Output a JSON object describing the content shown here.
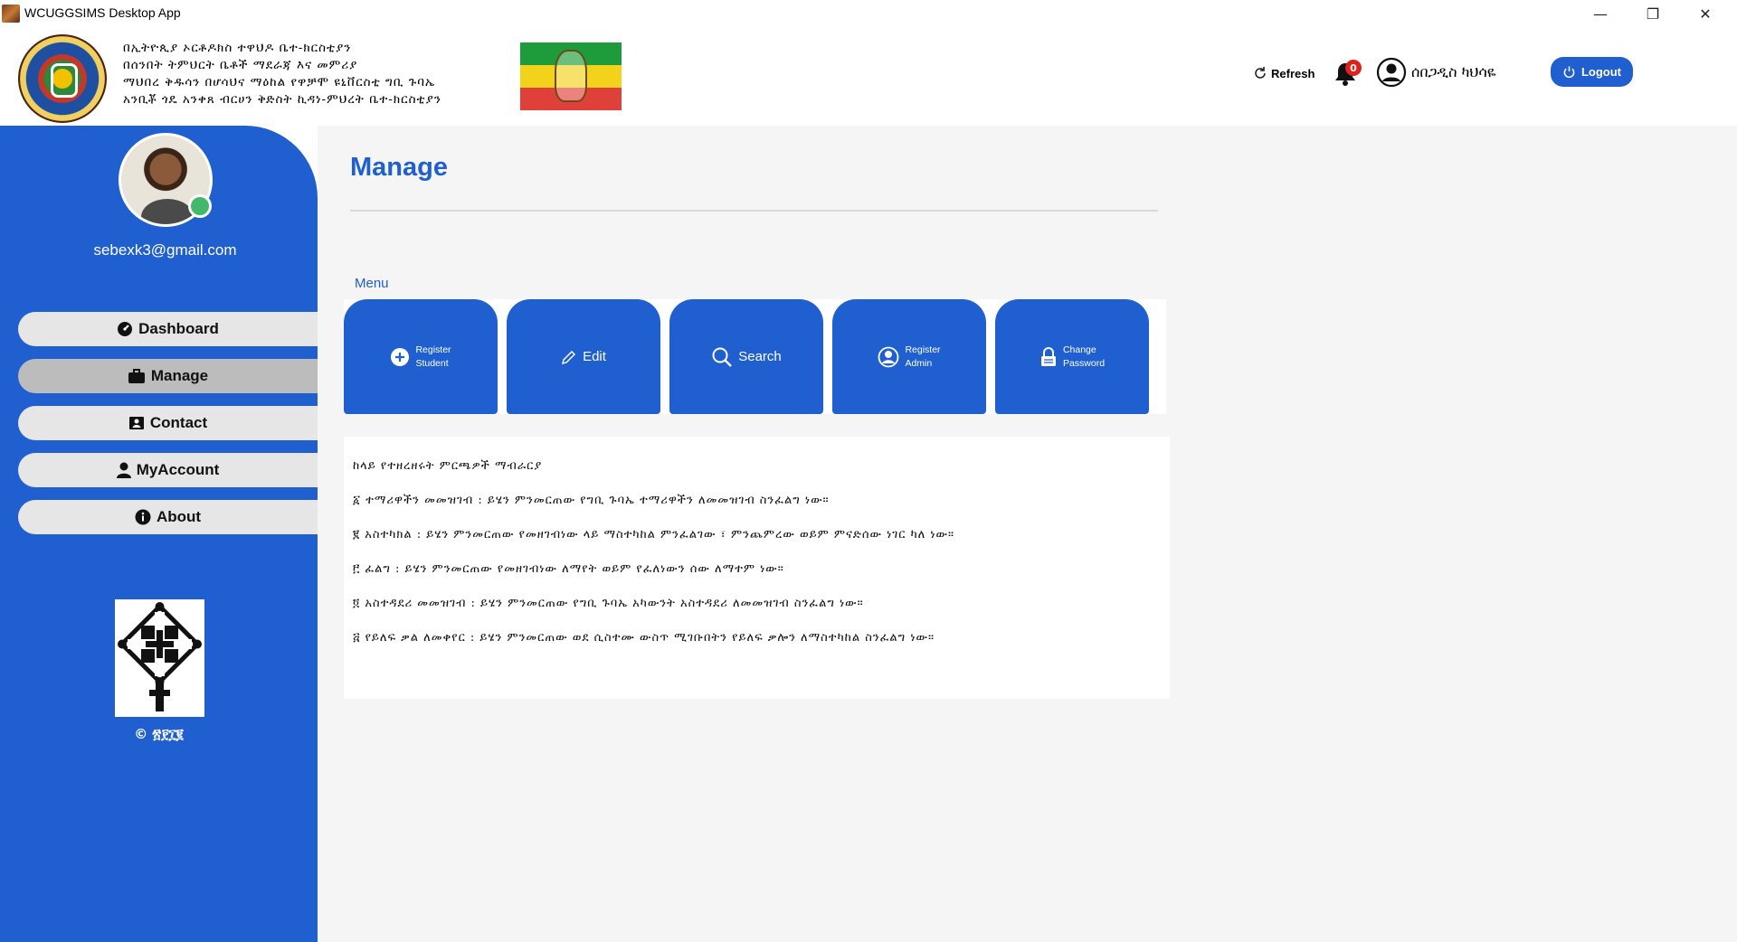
{
  "window": {
    "title": "WCUGGSIMS Desktop App",
    "minimize": "—",
    "maximize": "❐",
    "close": "✕"
  },
  "header": {
    "org_lines": [
      "በኢትዮጲያ ኦርቶዶክስ ተዋህዶ ቤተ-ክርስቲያን",
      "በሰንበት ትምህርት ቤቶች ማደራጃ እና መምሪያ",
      "ማህበረ ቅዱሳን በሆሳህና ማዕከል የዋቻሞ ዩኒቨርስቲ ግቢ ጉባኤ",
      "አንቢቾ ጎዴ አንቀጸ ብርሀን ቅድስት ኪዳነ-ምህረት ቤተ-ክርስቲያን"
    ],
    "refresh_label": "Refresh",
    "notification_count": "0",
    "user_name": "ሰበጋዲስ ካህሳዬ",
    "logout_label": "Logout"
  },
  "sidebar": {
    "email": "sebexk3@gmail.com",
    "nav": [
      {
        "label": "Dashboard",
        "icon": "dashboard-icon"
      },
      {
        "label": "Manage",
        "icon": "briefcase-icon"
      },
      {
        "label": "Contact",
        "icon": "contact-card-icon"
      },
      {
        "label": "MyAccount",
        "icon": "user-icon"
      },
      {
        "label": "About",
        "icon": "info-icon"
      }
    ],
    "copyright": "© ፳፻፲፪"
  },
  "main": {
    "title": "Manage",
    "menu_label": "Menu",
    "tiles": [
      {
        "line1": "Register",
        "line2": "Student",
        "icon": "plus-circle-icon"
      },
      {
        "line1": "Edit",
        "line2": "",
        "icon": "pencil-icon"
      },
      {
        "line1": "Search",
        "line2": "",
        "icon": "search-icon"
      },
      {
        "line1": "Register",
        "line2": "Admin",
        "icon": "user-circle-icon"
      },
      {
        "line1": "Change",
        "line2": "Password",
        "icon": "lock-icon"
      }
    ],
    "description": [
      "ከላይ የተዘረዘሩት ምርጫዎች ማብራርያ",
      "፩ ተማሪዋችን መመዝገብ : ይሄን ምንመርጠው የግቢ ጉባኤ ተማሪዋችን ለመመዝገብ ስንፈልግ ነው።",
      "፪ አስተካክል : ይሄን ምንመርጠው የመዘገብነው ላይ ማስተካከል ምንፈልገው ፣ ምንጨምረው ወይም ምናድሰው ነገር ካለ ነው።",
      "፫ ፈልግ : ይሄን ምንመርጠው የመዘገብነው ለማየት ወይም የፈለነውን ሰው ለማተም ነው።",
      "፬ አስተዳደሪ መመዝገብ : ይሄን ምንመርጠው የግቢ ጉባኤ አካውንት አስተዳደሪ ለመመዝገብ ስንፈልግ ነው።",
      "፭ የይለፍ ቃል ለመቀየር : ይሄን ምንመርጠው ወደ ሲስተሙ ውስጥ ሚገቡበትን የይለፍ ቃሎን ለማስተካከል ስንፈልግ ነው።"
    ]
  },
  "colors": {
    "primary": "#1f5fcf",
    "nav_bg": "#e6e6e6",
    "nav_active": "#bcbcbc",
    "online": "#43b86a",
    "badge": "#e0201a"
  }
}
